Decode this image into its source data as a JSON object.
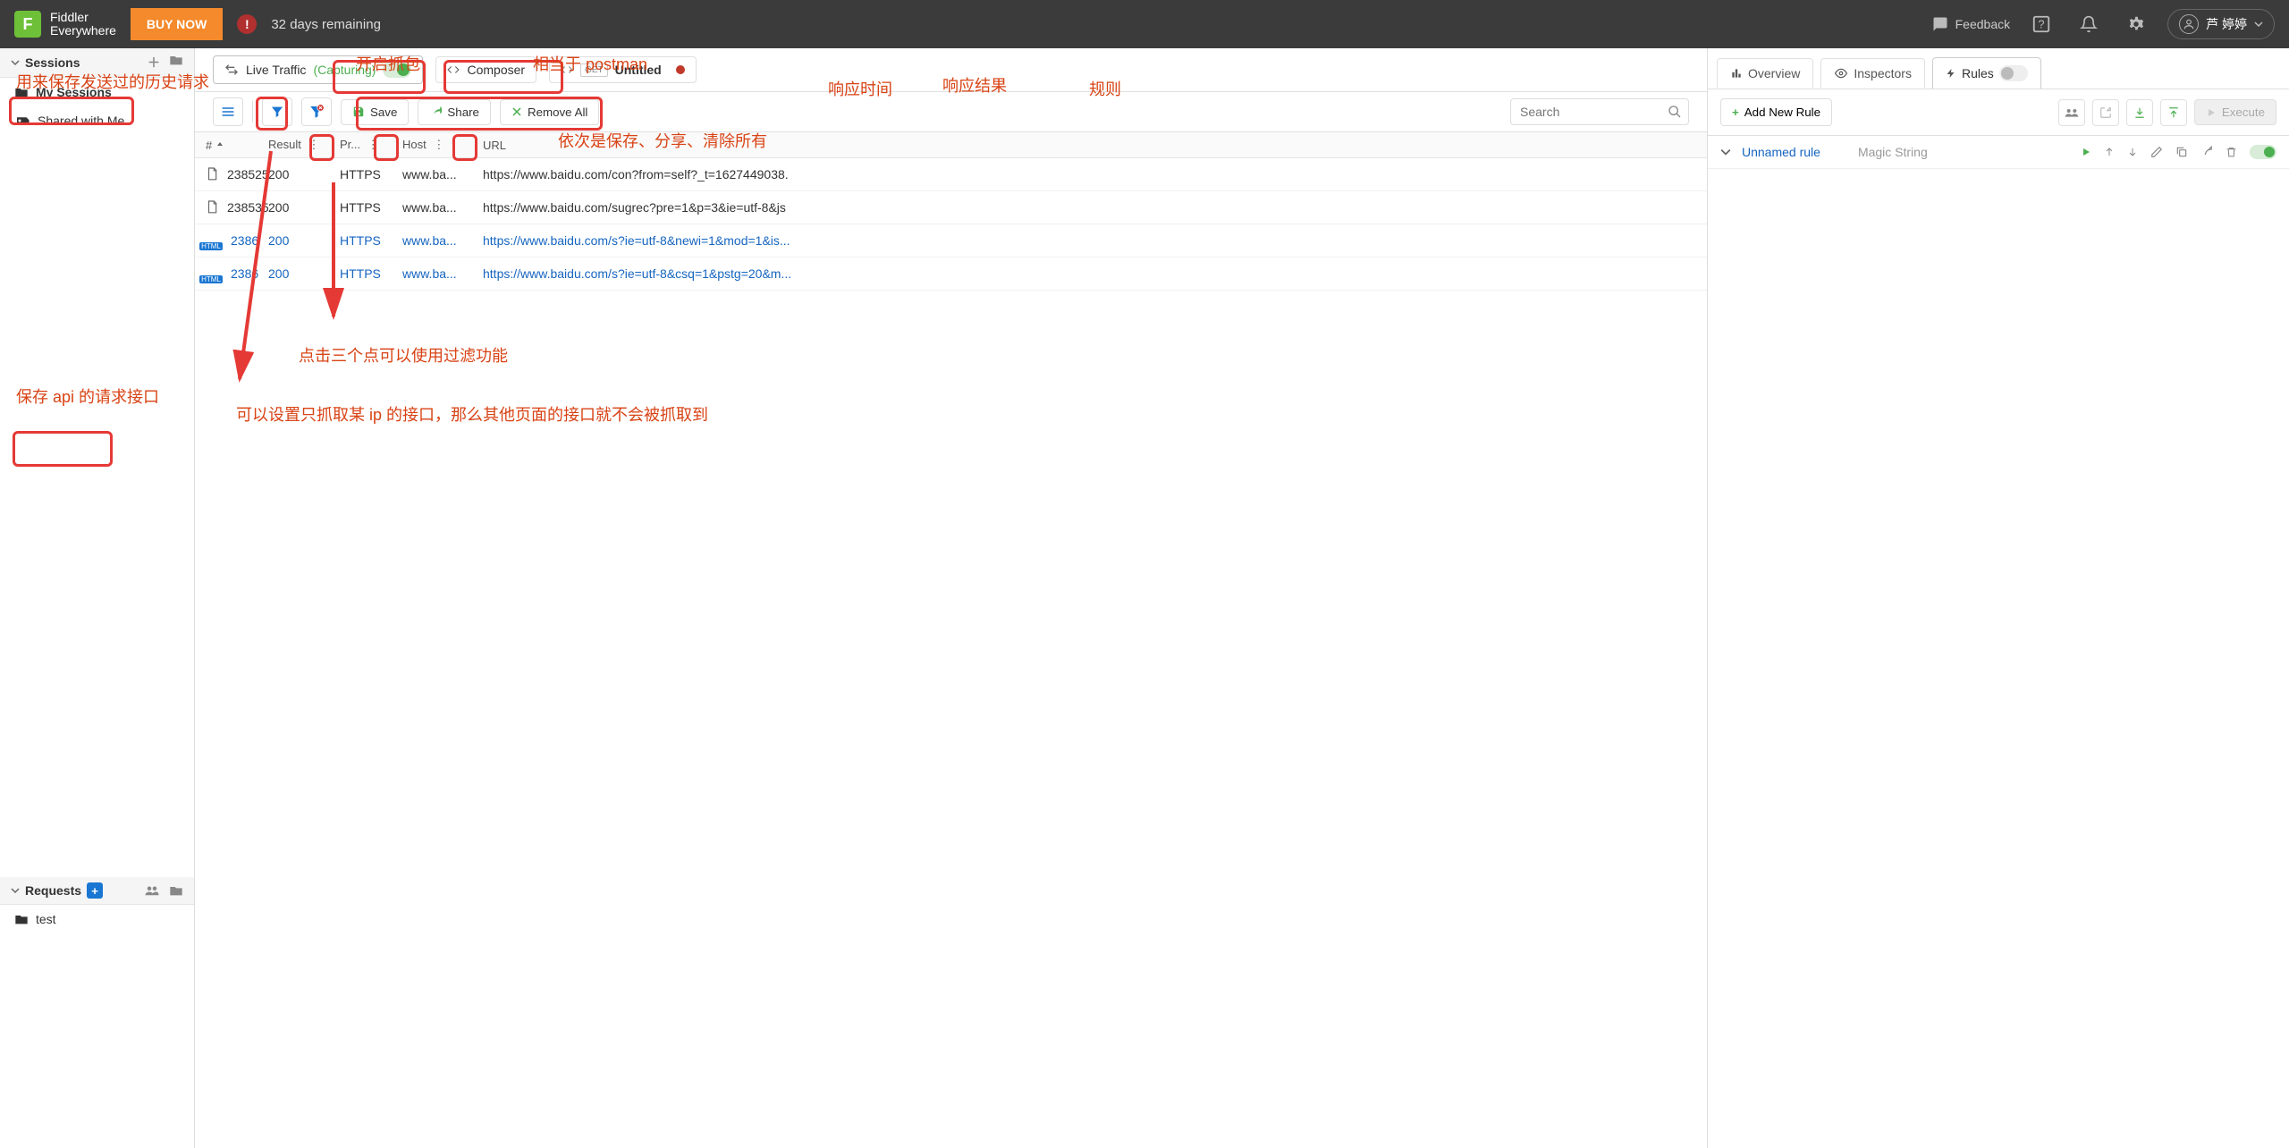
{
  "app": {
    "name_line1": "Fiddler",
    "name_line2": "Everywhere"
  },
  "topbar": {
    "buy": "BUY NOW",
    "days_remaining": "32 days remaining",
    "feedback": "Feedback",
    "user": "芦 婷婷"
  },
  "sidebar": {
    "sessions_label": "Sessions",
    "my_sessions": "My Sessions",
    "shared": "Shared with Me",
    "requests_label": "Requests",
    "item_test": "test"
  },
  "tabs": {
    "live_traffic": "Live Traffic",
    "capturing": "(Capturing)",
    "composer": "Composer",
    "untitled": "Untitled",
    "method": "GET"
  },
  "toolbar": {
    "save": "Save",
    "share": "Share",
    "remove_all": "Remove All",
    "search_placeholder": "Search"
  },
  "grid": {
    "headers": {
      "idx": "#",
      "result": "Result",
      "proto": "Pr...",
      "host": "Host",
      "url": "URL"
    },
    "rows": [
      {
        "id": "238525",
        "result": "200",
        "proto": "HTTPS",
        "host": "www.ba...",
        "url": "https://www.baidu.com/con?from=self?_t=1627449038.",
        "blue": false,
        "html": false
      },
      {
        "id": "238535",
        "result": "200",
        "proto": "HTTPS",
        "host": "www.ba...",
        "url": "https://www.baidu.com/sugrec?pre=1&p=3&ie=utf-8&js",
        "blue": false,
        "html": false
      },
      {
        "id": "2386",
        "result": "200",
        "proto": "HTTPS",
        "host": "www.ba...",
        "url": "https://www.baidu.com/s?ie=utf-8&newi=1&mod=1&is...",
        "blue": true,
        "html": true
      },
      {
        "id": "2386",
        "result": "200",
        "proto": "HTTPS",
        "host": "www.ba...",
        "url": "https://www.baidu.com/s?ie=utf-8&csq=1&pstg=20&m...",
        "blue": true,
        "html": true
      }
    ]
  },
  "right": {
    "overview": "Overview",
    "inspectors": "Inspectors",
    "rules": "Rules",
    "add_rule": "Add New Rule",
    "execute": "Execute",
    "rule_name": "Unnamed rule",
    "rule_match": "Magic String"
  },
  "annotations": {
    "a1": "用来保存发送过的历史请求",
    "a2": "开启抓包",
    "a3": "相当于 postman",
    "a4": "依次是保存、分享、清除所有",
    "a5": "响应时间",
    "a6": "响应结果",
    "a7": "规则",
    "a8": "点击三个点可以使用过滤功能",
    "a9": "可以设置只抓取某 ip 的接口，那么其他页面的接口就不会被抓取到",
    "a10": "保存 api 的请求接口"
  }
}
